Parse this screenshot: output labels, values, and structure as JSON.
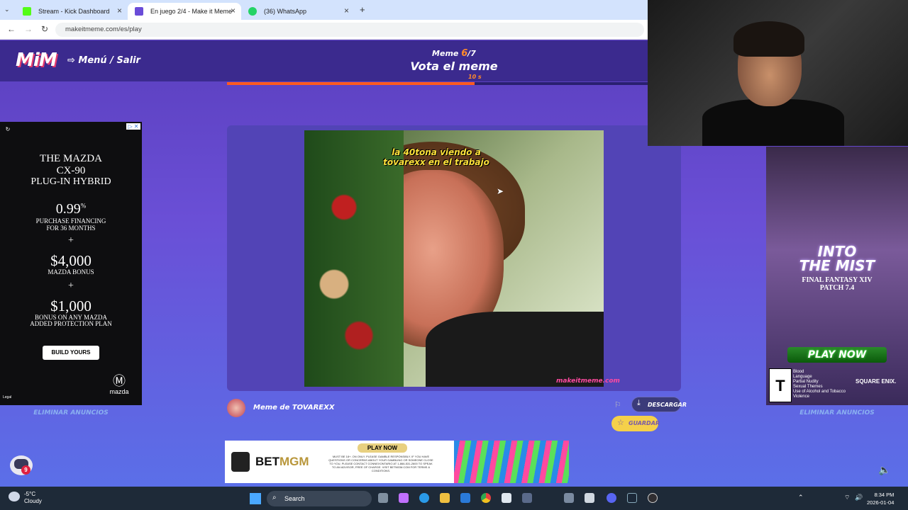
{
  "browser": {
    "tabs": [
      {
        "label": "Stream - Kick Dashboard",
        "color": "#53fc18"
      },
      {
        "label": "En juego 2/4 - Make it Meme",
        "color": "#6a4cd8"
      },
      {
        "label": "(36) WhatsApp",
        "color": "#25d366"
      }
    ],
    "url": "makeitmeme.com/es/play"
  },
  "header": {
    "logo": "MiM",
    "menu": "Menú / Salir",
    "meme_label": "Meme",
    "meme_current": "6",
    "meme_total": "/7",
    "title": "Vota el meme",
    "timer": "10 s",
    "progress": 0.545
  },
  "meme": {
    "caption_line1": "la 40tona viendo a",
    "caption_line2": "tovarexx en el trabajo",
    "watermark": "makeitmeme.com",
    "author": "Meme de TOVAREXX",
    "download": "DESCARGAR",
    "save": "GUARDAR"
  },
  "ad_left": {
    "line1": "THE MAZDA",
    "line2": "CX-90",
    "line3": "PLUG-IN HYBRID",
    "rate": "0.99",
    "rate_sup": "%",
    "rate_desc1": "PURCHASE FINANCING",
    "rate_desc2": "FOR 36 MONTHS",
    "plus": "+",
    "bonus1": "$4,000",
    "bonus1_desc": "MAZDA BONUS",
    "bonus2": "$1,000",
    "bonus2_desc1": "BONUS ON ANY MAZDA",
    "bonus2_desc2": "ADDED PROTECTION PLAN",
    "button": "BUILD YOURS",
    "brand": "mazda",
    "legal": "Legal"
  },
  "ad_right": {
    "title1": "INTO",
    "title2": "THE MIST",
    "sub1": "FINAL FANTASY XIV",
    "sub2": "PATCH 7.4",
    "play": "PLAY NOW",
    "rating": "T",
    "descriptors": [
      "Blood",
      "Language",
      "Partial Nudity",
      "Sexual Themes",
      "Use of Alcohol and Tobacco",
      "Violence"
    ],
    "publisher": "SQUARE ENIX."
  },
  "remove_ads": "ELIMINAR ANUNCIOS",
  "ad_bottom": {
    "brand_a": "BET",
    "brand_b": "MGM",
    "play": "PLAY NOW",
    "fine_print": "MUST BE 18+. ON ONLY. PLEASE GAMBLE RESPONSIBLY. IF YOU HAVE QUESTIONS OR CONCERNS ABOUT YOUR GAMBLING OR SOMEONE CLOSE TO YOU, PLEASE CONTACT CONNEXONTARIO AT 1-866-531-2600 TO SPEAK TO AN ADVISOR, FREE OF CHARGE. VISIT BETMGM.COM FOR TERMS & CONDITIONS."
  },
  "chat_badge": "9",
  "taskbar": {
    "temp": "-5°C",
    "weather": "Cloudy",
    "search": "Search",
    "time": "8:34 PM",
    "date": "2026-01-04"
  }
}
